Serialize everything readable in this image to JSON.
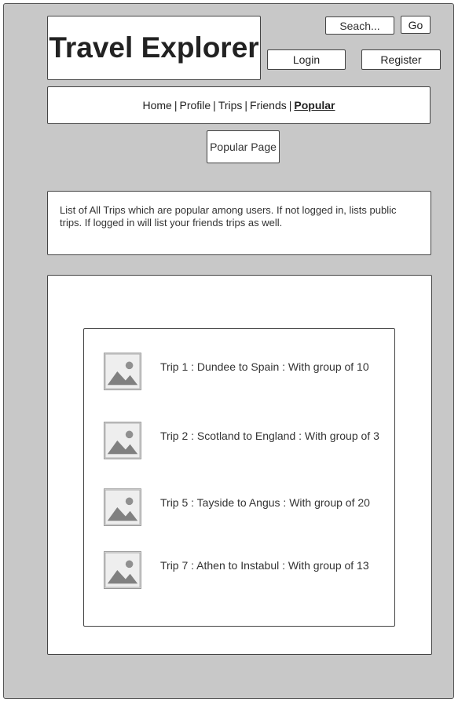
{
  "header": {
    "site_title": "Travel Explorer",
    "search_placeholder": "Seach...",
    "go_label": "Go",
    "login_label": "Login",
    "register_label": "Register"
  },
  "nav": {
    "items": [
      "Home",
      "Profile",
      "Trips",
      "Friends",
      "Popular"
    ],
    "active": "Popular",
    "separator": "|"
  },
  "page": {
    "title": "Popular Page",
    "description": "List of All Trips which are popular among users. If not logged in, lists public trips. If logged in will list your friends trips as well."
  },
  "trips": [
    {
      "label": "Trip 1 : Dundee to Spain : With group of 10",
      "icon": "image-placeholder-icon"
    },
    {
      "label": "Trip 2 : Scotland to England : With group of 3",
      "icon": "image-placeholder-icon"
    },
    {
      "label": "Trip 5 : Tayside to Angus : With group of 20",
      "icon": "image-placeholder-icon"
    },
    {
      "label": "Trip 7 : Athen to Instabul : With group of 13",
      "icon": "image-placeholder-icon"
    }
  ]
}
